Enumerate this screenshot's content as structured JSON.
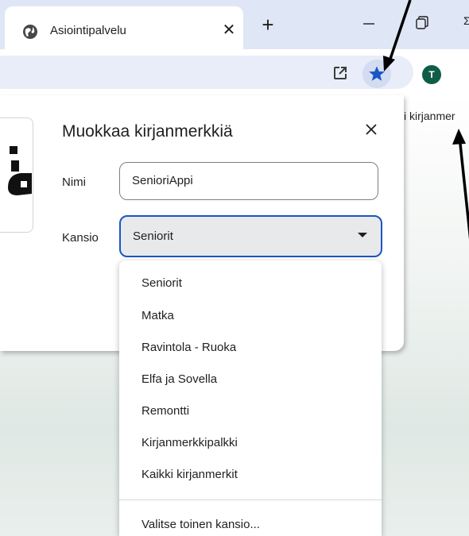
{
  "tab": {
    "title": "Asiointipalvelu",
    "close_icon": "close-icon",
    "icon": "globe-icon"
  },
  "toolbar": {
    "avatar_letter": "T",
    "star_color": "#1a56c5"
  },
  "page": {
    "bookmarks_text": "i kirjanmer"
  },
  "dialog": {
    "title": "Muokkaa kirjanmerkkiä",
    "name_label": "Nimi",
    "name_value": "SenioriAppi",
    "folder_label": "Kansio",
    "folder_value": "Seniorit"
  },
  "dropdown": {
    "options": [
      "Seniorit",
      "Matka",
      "Ravintola - Ruoka",
      "Elfa ja Sovella",
      "Remontti",
      "Kirjanmerkkipalkki",
      "Kaikki kirjanmerkit"
    ],
    "other_folder": "Valitse toinen kansio..."
  },
  "colors": {
    "accent": "#1a56c5",
    "tabstrip": "#dfe6f6",
    "avatar": "#0f5d47"
  }
}
